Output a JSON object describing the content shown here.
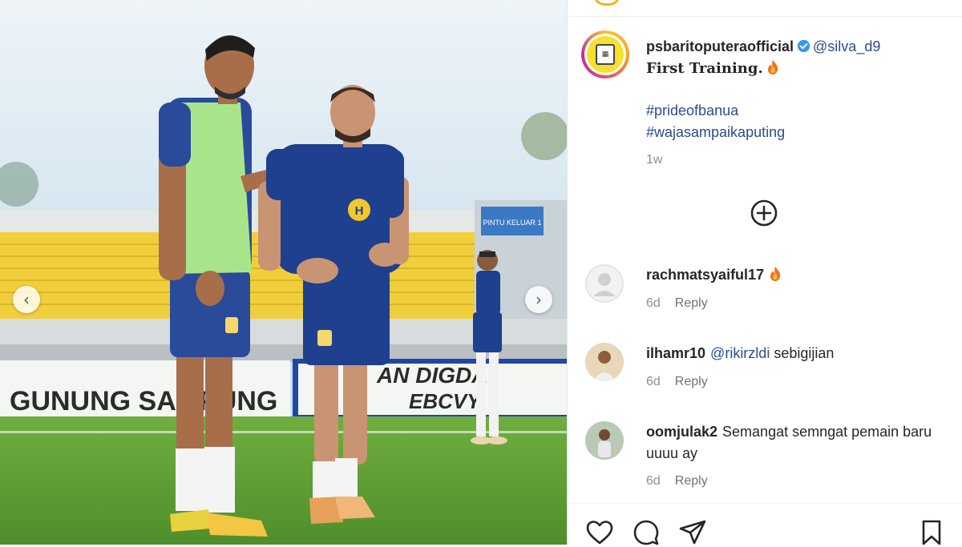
{
  "post": {
    "username": "psbaritoputeraofficial",
    "mention": "@silva_d9",
    "title": "First Training.",
    "hashtags": [
      "#prideofbanua",
      "#wajasampaikaputing"
    ],
    "time": "1w"
  },
  "photo": {
    "banner_left": "GUNUNG SAMPUNG",
    "banner_right_top": "AN DIGDA",
    "banner_right_bottom": "EBCVY",
    "stadium_sign": "PINTU KELUAR 1"
  },
  "comments": [
    {
      "username": "rachmatsyaiful17",
      "mention": "",
      "text": "",
      "has_fire": true,
      "time": "6d",
      "reply_label": "Reply"
    },
    {
      "username": "ilhamr10",
      "mention": "@rikirzldi",
      "text": "sebigijian",
      "has_fire": false,
      "time": "6d",
      "reply_label": "Reply"
    },
    {
      "username": "oomjulak2",
      "mention": "",
      "text": "Semangat semngat pemain baru uuuu ay",
      "has_fire": false,
      "time": "6d",
      "reply_label": "Reply"
    }
  ],
  "colors": {
    "link": "#2a4d8f",
    "verified": "#3897f0",
    "meta": "#8e8e8e",
    "kit_blue": "#1f3f8f",
    "bib_green": "#a8e58a",
    "seats_yellow": "#f1cf3c"
  },
  "icons": {
    "prev": "chevron-left-icon",
    "next": "chevron-right-icon",
    "add_comment": "plus-circle-icon",
    "like": "heart-icon",
    "comment": "comment-icon",
    "share": "share-icon",
    "save": "bookmark-icon"
  }
}
